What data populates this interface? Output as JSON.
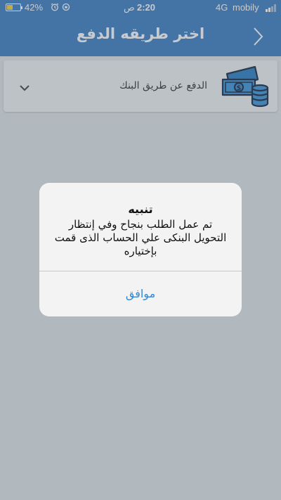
{
  "status_bar": {
    "battery": "42%",
    "time": "2:20",
    "am_pm": "ص",
    "network": "4G",
    "carrier": "mobily"
  },
  "header": {
    "title": "اختر طريقه الدفع",
    "back_icon": "chevron-right-icon"
  },
  "payment_method": {
    "label": "الدفع عن طريق البنك",
    "icon": "cash-coins-icon",
    "dropdown_icon": "chevron-down-icon"
  },
  "alert": {
    "title": "تنبيه",
    "message": "تم عمل الطلب بنجاح وفي إنتظار التحويل البنكى علي الحساب الذى قمت بإختياره",
    "ok_label": "موافق"
  },
  "colors": {
    "accent": "#3f7fc1",
    "alert_button": "#2f88d8",
    "battery": "#f5d23a"
  }
}
